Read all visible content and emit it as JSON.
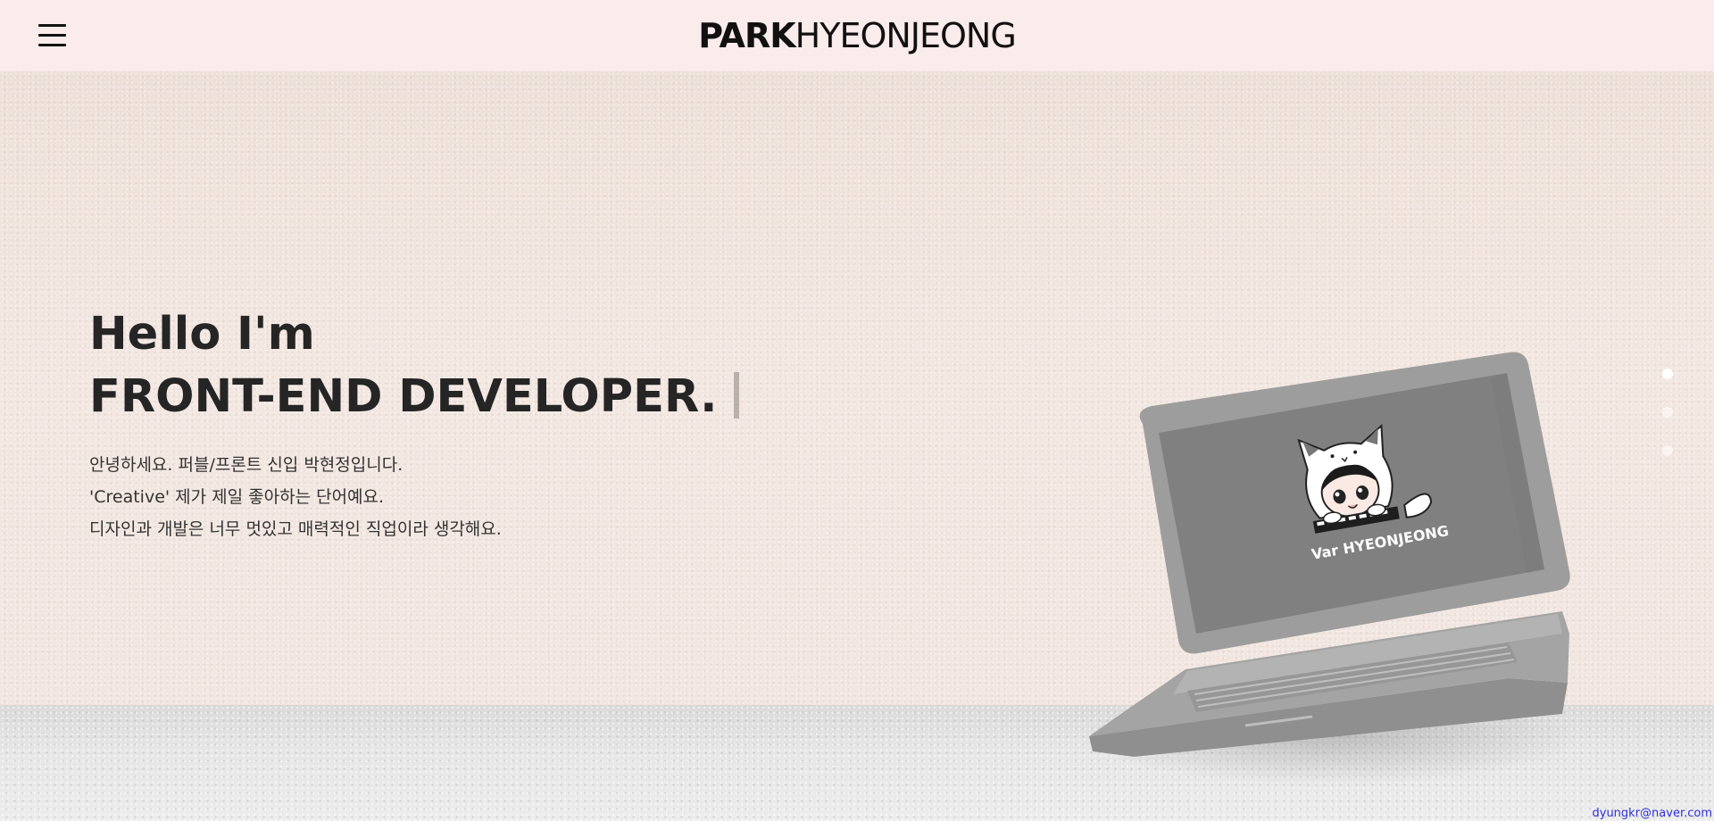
{
  "header": {
    "logo_bold": "PARK",
    "logo_light": "HYEONJEONG",
    "menu_icon": "hamburger-icon"
  },
  "hero": {
    "title_line1": "Hello I'm",
    "title_line2": "FRONT-END DEVELOPER.",
    "intro": [
      "안녕하세요. 퍼블/프론트 신입 박현정입니다.",
      "'Creative' 제가 제일 좋아하는 단어예요.",
      "디자인과 개발은 너무 멋있고 매력적인 직업이라 생각해요."
    ]
  },
  "laptop_screen": {
    "caption": "Var HYEONJEONG"
  },
  "pagination": {
    "count": 3,
    "active_index": 0
  },
  "footer": {
    "email": "dyungkr@naver.com"
  },
  "colors": {
    "header_bg": "#faeceb",
    "paper_bg": "#f1e5df",
    "floor_bg": "#e3e3e3",
    "title_text": "#252525",
    "email_link": "#2f2fd8"
  }
}
